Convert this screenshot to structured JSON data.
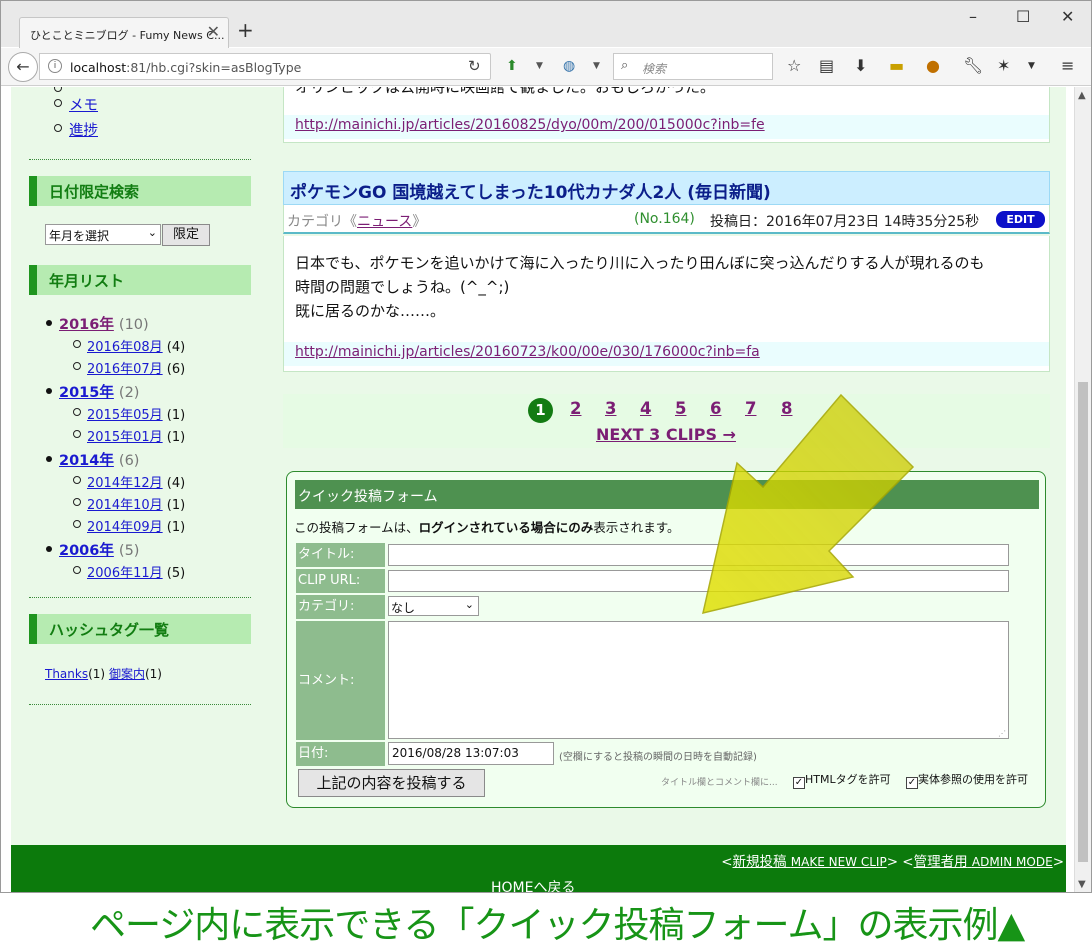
{
  "browser": {
    "tab_title": "ひとことミニブログ - Fumy News C...",
    "tab_close": "✕",
    "new_tab": "+",
    "url_host": "localhost",
    "url_rest": ":81/hb.cgi?skin=asBlogType",
    "search_placeholder": "検索",
    "win_min": "–",
    "win_max": "☐",
    "win_close": "✕"
  },
  "sidebar": {
    "cat_items": [
      {
        "label": "メモ"
      },
      {
        "label": "進捗"
      }
    ],
    "date_search": {
      "heading": "日付限定検索",
      "select_value": "年月を選択",
      "button": "限定"
    },
    "month_list": {
      "heading": "年月リスト",
      "years": [
        {
          "year": "2016年",
          "count": "(10)",
          "months": [
            {
              "m": "2016年08月",
              "c": "(4)"
            },
            {
              "m": "2016年07月",
              "c": "(6)"
            }
          ]
        },
        {
          "year": "2015年",
          "count": "(2)",
          "months": [
            {
              "m": "2015年05月",
              "c": "(1)"
            },
            {
              "m": "2015年01月",
              "c": "(1)"
            }
          ]
        },
        {
          "year": "2014年",
          "count": "(6)",
          "months": [
            {
              "m": "2014年12月",
              "c": "(4)"
            },
            {
              "m": "2014年10月",
              "c": "(1)"
            },
            {
              "m": "2014年09月",
              "c": "(1)"
            }
          ]
        },
        {
          "year": "2006年",
          "count": "(5)",
          "months": [
            {
              "m": "2006年11月",
              "c": "(5)"
            }
          ]
        }
      ]
    },
    "hashtags": {
      "heading": "ハッシュタグ一覧",
      "tags": [
        {
          "t": "Thanks",
          "c": "(1)"
        },
        {
          "t": "御案内",
          "c": "(1)"
        }
      ]
    }
  },
  "articles": {
    "prev": {
      "text": "オリンピックは公開時に映画館で観ました。おもしろかった。",
      "link": "http://mainichi.jp/articles/20160825/dyo/00m/200/015000c?inb=fe"
    },
    "main": {
      "title": "ポケモンGO 国境越えてしまった10代カナダ人2人 (毎日新聞)",
      "cat_prefix": "カテゴリ《",
      "category": "ニュース",
      "cat_suffix": "》",
      "number": "(No.164)",
      "posted": "投稿日：2016年07月23日 14時35分25秒",
      "edit": "EDIT",
      "body": [
        "日本でも、ポケモンを追いかけて海に入ったり川に入ったり田んぼに突っ込んだりする人が現れるのも",
        "時間の問題でしょうね。(^_^;)",
        "既に居るのかな……。"
      ],
      "link": "http://mainichi.jp/articles/20160723/k00/00e/030/176000c?inb=fa"
    }
  },
  "pager": {
    "current": "1",
    "pages": [
      "2",
      "3",
      "4",
      "5",
      "6",
      "7",
      "8"
    ],
    "next": "NEXT 3 CLIPS →"
  },
  "quick_form": {
    "heading": "クイック投稿フォーム",
    "note_a": "この投稿フォームは、",
    "note_b": "ログインされている場合にのみ",
    "note_c": "表示されます。",
    "title_label": "タイトル:",
    "url_label": "CLIP URL:",
    "category_label": "カテゴリ:",
    "category_value": "なし",
    "comment_label": "コメント:",
    "date_label": "日付:",
    "date_value": "2016/08/28 13:07:03",
    "date_hint": "(空欄にすると投稿の瞬間の日時を自動記録)",
    "submit": "上記の内容を投稿する",
    "options_hint": "タイトル欄とコメント欄に...",
    "opt_html": "HTMLタグを許可",
    "opt_entity": "実体参照の使用を許可"
  },
  "footer": {
    "new_post": "新規投稿",
    "new_post_en": "MAKE NEW CLIP",
    "admin": "管理者用",
    "admin_en": "ADMIN MODE",
    "home": "HOMEへ戻る"
  },
  "caption": "ページ内に表示できる「クイック投稿フォーム」の表示例▲",
  "colors": {
    "accent_green": "#127d12",
    "highlight_arrow": "#e8e000",
    "link": "#1a1ad0",
    "visited": "#7b1e74"
  }
}
